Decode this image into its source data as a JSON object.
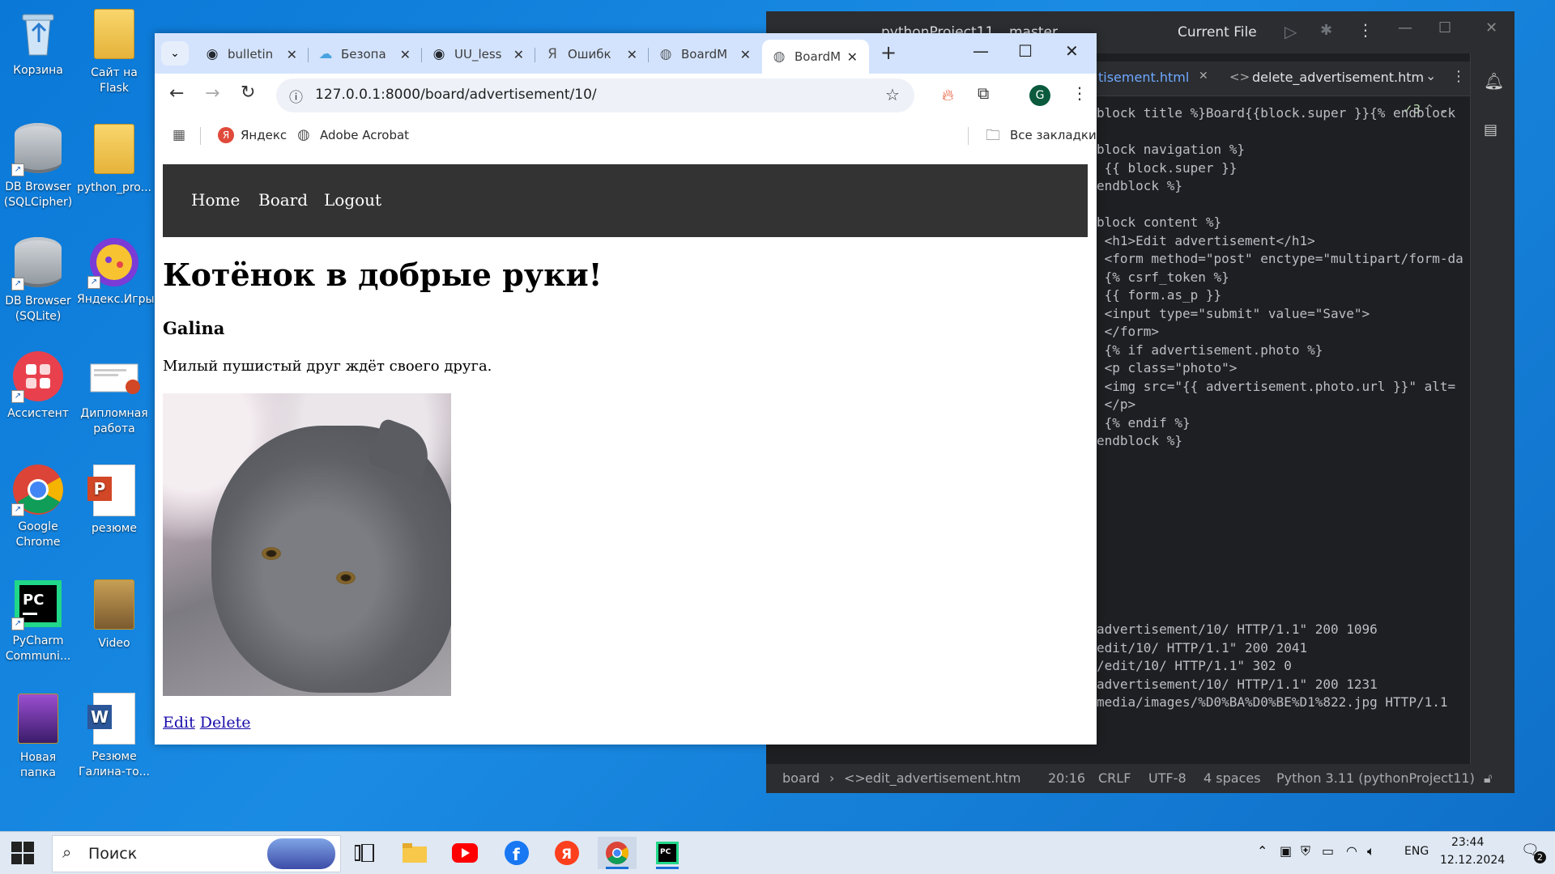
{
  "desktop": {
    "icons": [
      {
        "label": "Корзина"
      },
      {
        "label": "Сайт на Flask"
      },
      {
        "label": "DB Browser (SQLCipher)"
      },
      {
        "label": "python_pro..."
      },
      {
        "label": "DB Browser (SQLite)"
      },
      {
        "label": "Яндекс.Игры"
      },
      {
        "label": "Ассистент"
      },
      {
        "label": "Дипломная работа"
      },
      {
        "label": "Google Chrome"
      },
      {
        "label": "резюме"
      },
      {
        "label": "PyCharm Communi..."
      },
      {
        "label": "Video"
      },
      {
        "label": "Новая папка"
      },
      {
        "label": "Резюме Галина-то..."
      }
    ]
  },
  "browser": {
    "tabs": [
      {
        "label": "bulletin",
        "icon": "github-icon"
      },
      {
        "label": "Безопа",
        "icon": "cloud-icon"
      },
      {
        "label": "UU_less",
        "icon": "github-icon"
      },
      {
        "label": "Ошибк",
        "icon": "yandex-icon"
      },
      {
        "label": "BoardM",
        "icon": "globe-icon"
      },
      {
        "label": "BoardM",
        "icon": "globe-icon",
        "active": true
      }
    ],
    "url": "127.0.0.1:8000/board/advertisement/10/",
    "bookmarks": [
      {
        "label": "Яндекс"
      },
      {
        "label": "Adobe Acrobat"
      }
    ],
    "all_bookmarks": "Все закладки",
    "profile_initial": "G"
  },
  "page": {
    "nav": [
      "Home",
      "Board",
      "Logout"
    ],
    "title": "Котёнок в добрые руки!",
    "author": "Galina",
    "description": "Милый пушистый друг ждёт своего друга.",
    "edit_link": "Edit",
    "delete_link": "Delete"
  },
  "ide": {
    "project": "pythonProject11",
    "branch": "master",
    "run_config": "Current File",
    "tabs": [
      {
        "label": "tisement.html"
      },
      {
        "label": "delete_advertisement.htm"
      }
    ],
    "inspection_count": "3",
    "code_lines": [
      "block title %}Board{{block.super }}{% endblock",
      "",
      "block navigation %}",
      " {{ block.super }}",
      "endblock %}",
      "",
      "block content %}",
      " <h1>Edit advertisement</h1>",
      " <form method=\"post\" enctype=\"multipart/form-da",
      " {% csrf_token %}",
      " {{ form.as_p }}",
      " <input type=\"submit\" value=\"Save\">",
      " </form>",
      " {% if advertisement.photo %}",
      " <p class=\"photo\">",
      " <img src=\"{{ advertisement.photo.url }}\" alt=",
      " </p>",
      " {% endif %}",
      "endblock %}"
    ],
    "console_lines": [
      "advertisement/10/ HTTP/1.1\" 200 1096",
      "edit/10/ HTTP/1.1\" 200 2041",
      "/edit/10/ HTTP/1.1\" 302 0",
      "advertisement/10/ HTTP/1.1\" 200 1231",
      "media/images/%D0%BA%D0%BE%D1%822.jpg HTTP/1.1"
    ],
    "status": {
      "breadcrumb_root": "board",
      "breadcrumb_file": "edit_advertisement.htm",
      "position": "20:16",
      "line_sep": "CRLF",
      "encoding": "UTF-8",
      "indent": "4 spaces",
      "interpreter": "Python 3.11 (pythonProject11)"
    }
  },
  "taskbar": {
    "search_placeholder": "Поиск",
    "lang": "ENG",
    "time": "23:44",
    "date": "12.12.2024",
    "notifications": "2"
  }
}
